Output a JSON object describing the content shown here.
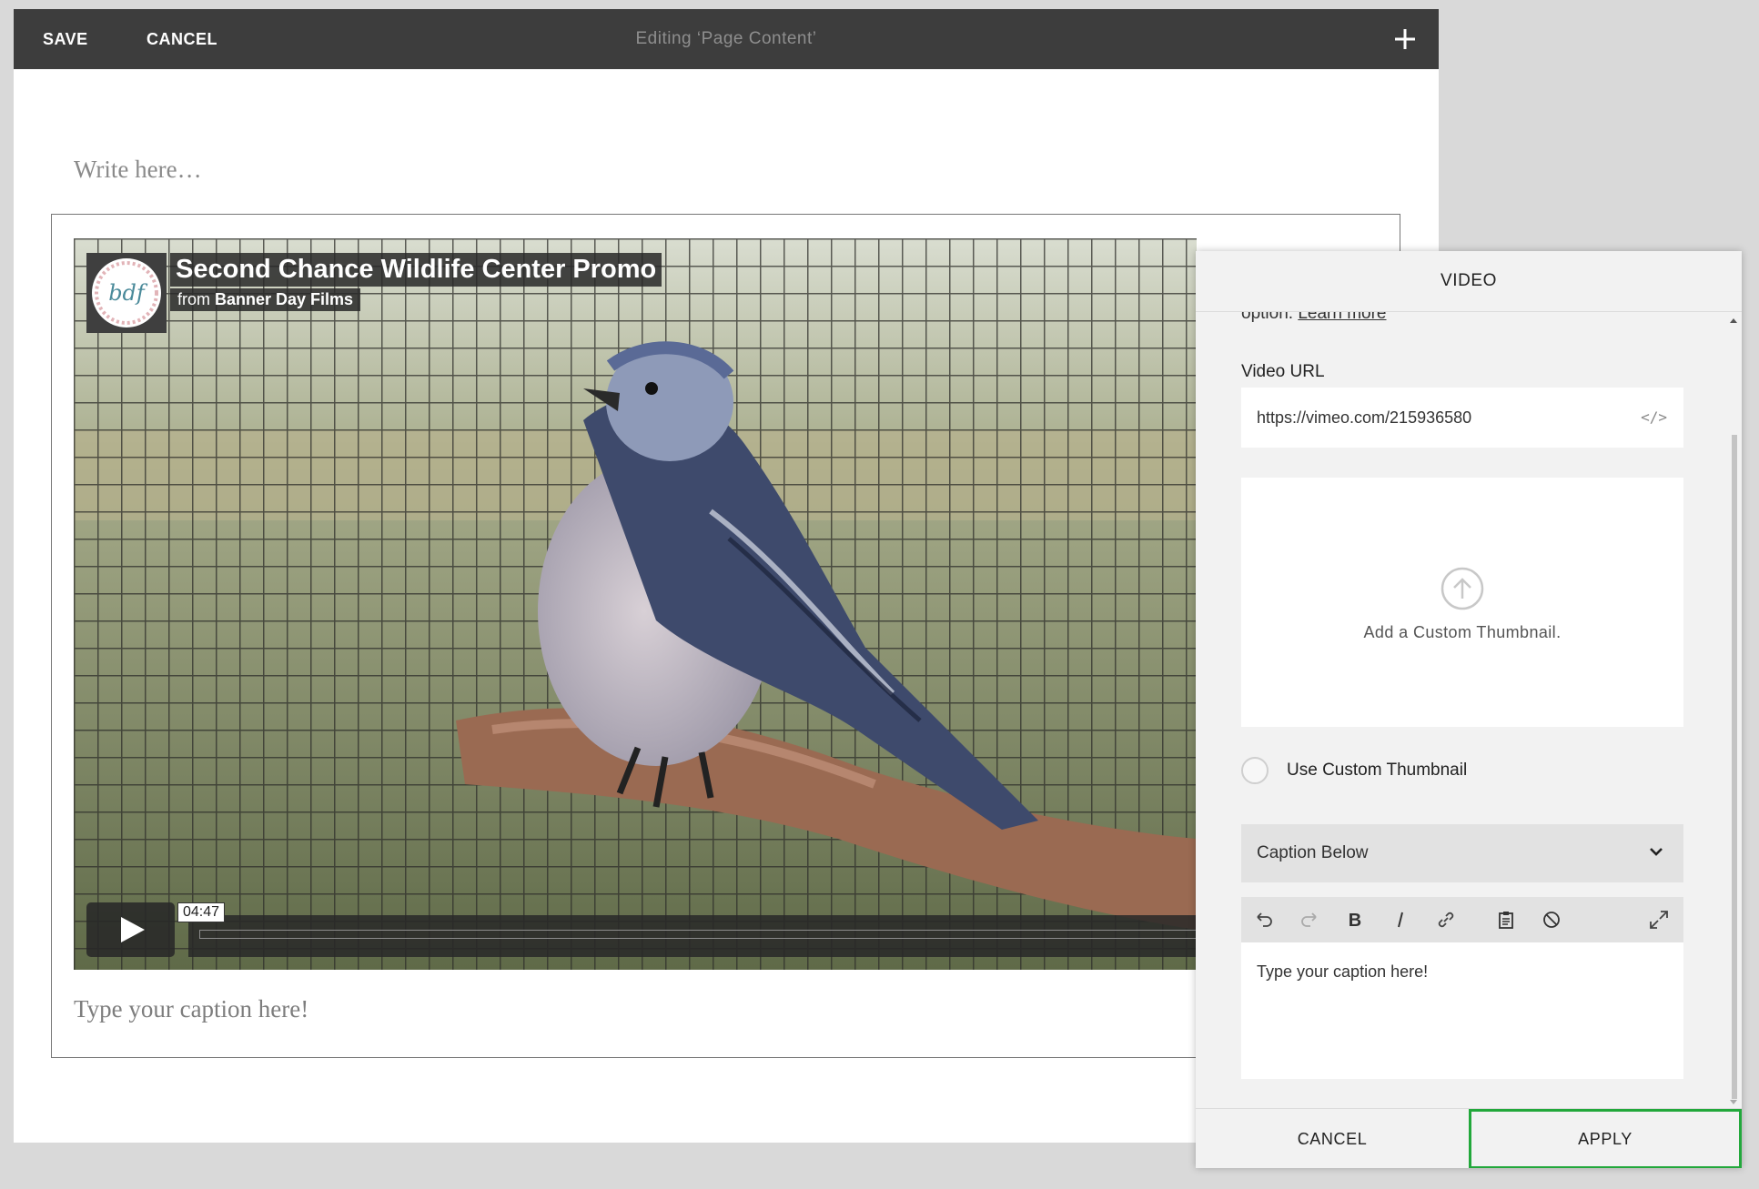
{
  "toolbar": {
    "save_label": "SAVE",
    "cancel_label": "CANCEL",
    "title": "Editing ‘Page Content’"
  },
  "content": {
    "placeholder": "Write here…",
    "caption": "Type your caption here!"
  },
  "video": {
    "title": "Second Chance Wildlife Center Promo",
    "byline_prefix": "from",
    "byline_author": "Banner Day Films",
    "logo_text": "bdf",
    "time": "04:47"
  },
  "panel": {
    "title": "VIDEO",
    "clipped_text": "option. ",
    "learn_more": "Learn more",
    "video_url_label": "Video URL",
    "video_url": "https://vimeo.com/215936580",
    "embed_icon": "</>",
    "thumbnail_label": "Add a Custom Thumbnail.",
    "use_custom_thumbnail": "Use Custom Thumbnail",
    "caption_position": "Caption Below",
    "caption_text": "Type your caption here!",
    "cancel_label": "CANCEL",
    "apply_label": "APPLY"
  },
  "colors": {
    "toolbar_bg": "#3d3d3d",
    "apply_highlight": "#22a83b"
  }
}
